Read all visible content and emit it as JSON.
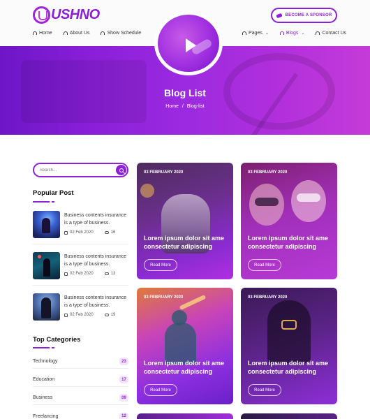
{
  "brand": {
    "logo_text": "USHNO",
    "accent": "#8d1fd8"
  },
  "header": {
    "sponsor_label": "BECOME A SPONSOR",
    "nav_left": [
      {
        "label": "Home"
      },
      {
        "label": "About Us"
      },
      {
        "label": "Show Schedule"
      }
    ],
    "nav_right": [
      {
        "label": "Pages",
        "caret": "⌄",
        "active": false
      },
      {
        "label": "Blogs",
        "caret": "⌄",
        "active": true
      },
      {
        "label": "Contact Us",
        "active": false
      }
    ]
  },
  "hero": {
    "title": "Blog List",
    "breadcrumb": {
      "home": "Home",
      "sep": "/",
      "current": "Blog-list"
    }
  },
  "sidebar": {
    "search_placeholder": "Search...",
    "popular_title": "Popular Post",
    "popular_posts": [
      {
        "title": "Business contents insurance is a type of business.",
        "date": "02 Feb 2020",
        "comments": "16"
      },
      {
        "title": "Business contents insurance is a type of business.",
        "date": "02 Feb 2020",
        "comments": "13"
      },
      {
        "title": "Business contents insurance is a type of business.",
        "date": "02 Feb 2020",
        "comments": "19"
      }
    ],
    "categories_title": "Top Categories",
    "categories": [
      {
        "name": "Technology",
        "count": "23"
      },
      {
        "name": "Education",
        "count": "17"
      },
      {
        "name": "Business",
        "count": "09"
      },
      {
        "name": "Freelancing",
        "count": "12"
      }
    ]
  },
  "cards": [
    {
      "date": "03 FEBRUARY 2020",
      "title": "Lorem ipsum dolor sit ame consectetur adipiscing",
      "button": "Read More"
    },
    {
      "date": "03 FEBRUARY 2020",
      "title": "Lorem ipsum dolor sit ame consectetur adipiscing",
      "button": "Read More"
    },
    {
      "date": "03 FEBRUARY 2020",
      "title": "Lorem ipsum dolor sit ame consectetur adipiscing",
      "button": "Read More"
    },
    {
      "date": "03 FEBRUARY 2020",
      "title": "Lorem ipsum dolor sit ame consectetur adipiscing",
      "button": "Read More"
    }
  ]
}
